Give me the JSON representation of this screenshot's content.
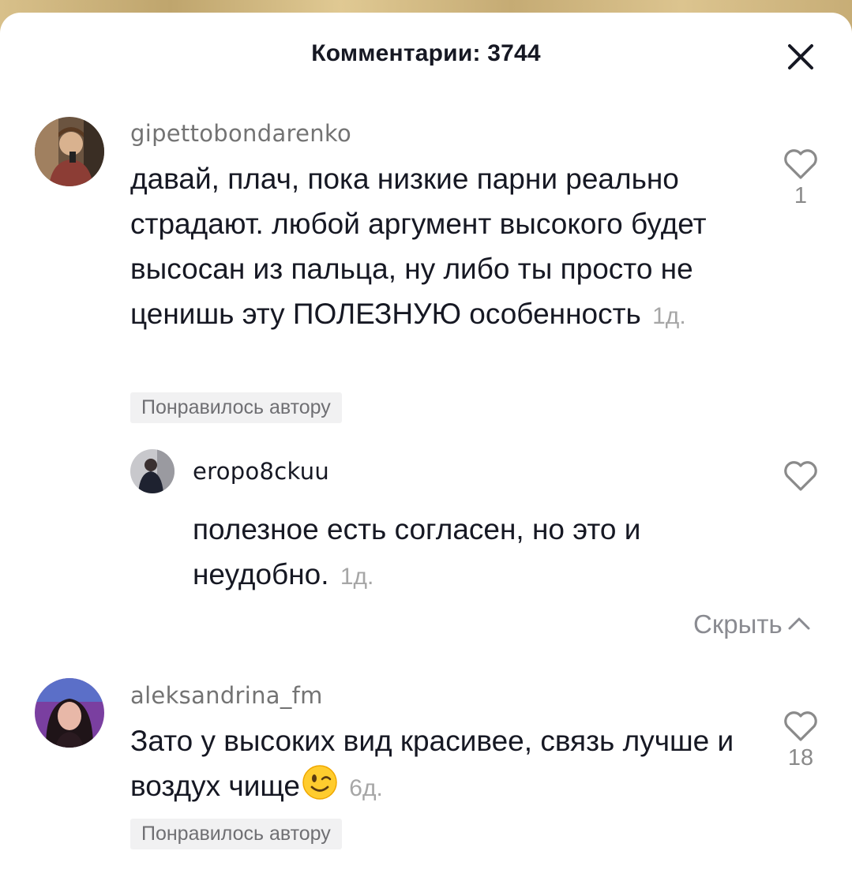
{
  "header": {
    "title": "Комментарии: 3744"
  },
  "comments": [
    {
      "username": "gipettobondarenko",
      "text": "давай, плач, пока низкие парни реально страдают. любой аргумент высокого будет высосан из пальца, ну либо ты просто не ценишь эту ПОЛЕЗНУЮ особенность",
      "time": "1д.",
      "badge": "Понравилось автору",
      "likes": "1",
      "replies": [
        {
          "username": "eropo8ckuu",
          "text": "полезное есть согласен, но это и неудобно.",
          "time": "1д."
        }
      ],
      "hide_label": "Скрыть"
    },
    {
      "username": "aleksandrina_fm",
      "text": "Зато у высоких вид красивее, связь лучше и воздух чище",
      "emoji": "winking-face-emoji",
      "time": "6д.",
      "badge": "Понравилось автору",
      "likes": "18"
    }
  ],
  "icons": {
    "close": "close-icon",
    "like": "heart-outline-icon",
    "hide": "chevron-up-icon"
  },
  "colors": {
    "text": "#161823",
    "username": "#737373",
    "muted": "#a6a6a6",
    "badge_bg": "#f1f1f2"
  }
}
